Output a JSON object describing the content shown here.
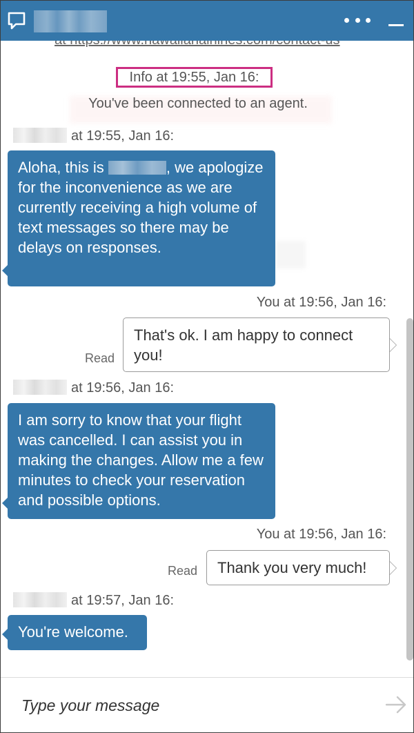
{
  "header": {
    "chat_icon": "chat-bubble-icon",
    "more_icon": "more-horizontal-icon",
    "minimize_icon": "minimize-icon"
  },
  "transcript": {
    "cut_link": "at https://www.hawaiianairlines.com/contact-us",
    "info_label": "Info at 19:55, Jan 16:",
    "info_text": "You've been connected to an agent.",
    "messages": [
      {
        "sender": "agent",
        "timestamp": "at 19:55, Jan 16:",
        "text_before": "Aloha, this is ",
        "text_after": ", we apologize for the inconvenience as we are currently receiving a high volume of text messages so there may be delays on responses."
      },
      {
        "sender": "user",
        "timestamp": "You at 19:56, Jan 16:",
        "text": "That's ok. I am happy to connect you!",
        "status": "Read"
      },
      {
        "sender": "agent",
        "timestamp": "at 19:56, Jan 16:",
        "text": "I am sorry to know that your flight was cancelled. I can assist you in making the changes. Allow me a few minutes to check your reservation and possible options."
      },
      {
        "sender": "user",
        "timestamp": "You at 19:56, Jan 16:",
        "text": "Thank you very much!",
        "status": "Read"
      },
      {
        "sender": "agent",
        "timestamp": "at 19:57, Jan 16:",
        "text": "You're welcome."
      }
    ]
  },
  "composer": {
    "placeholder": "Type your message",
    "send_icon": "arrow-right-icon"
  },
  "colors": {
    "header": "#3577aa",
    "agent_bubble": "#3577aa",
    "highlight_box": "#cc2e82"
  }
}
